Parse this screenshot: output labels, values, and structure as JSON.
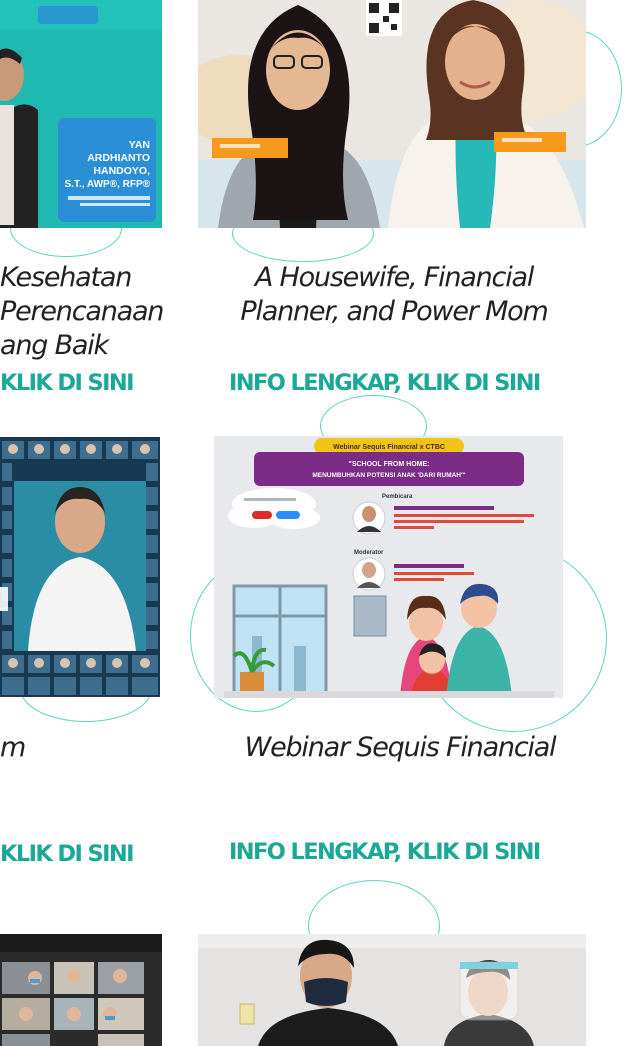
{
  "cards": {
    "top_left": {
      "caption_lines": [
        "Kesehatan",
        "Perencanaan",
        "ang Baik"
      ],
      "cta": "KLIK DI SINI",
      "image_text": {
        "name_lines": [
          "YAN",
          "ARDHIANTO",
          "HANDOYO,",
          "S.T., AWP®, RFP®"
        ]
      }
    },
    "top_right": {
      "caption_lines": [
        "A Housewife, Financial",
        "Planner, and Power Mom"
      ],
      "cta": "INFO LENGKAP, KLIK DI SINI"
    },
    "middle_left": {
      "caption_lines": [
        "m"
      ],
      "cta": "KLIK DI SINI"
    },
    "middle_right": {
      "caption_lines": [
        "Webinar Sequis Financial"
      ],
      "cta": "INFO LENGKAP, KLIK DI SINI",
      "image_text": {
        "badge": "Webinar Sequis Financial x CTBC",
        "banner_lines": [
          "\"SCHOOL FROM HOME:",
          "MENUMBUHKAN POTENSI ANAK 'DARI RUMAH'\""
        ],
        "section_1": "Pembicara",
        "section_2": "Moderator"
      }
    },
    "bottom_left": {
      "caption_lines": [],
      "cta": ""
    },
    "bottom_right": {
      "caption_lines": [],
      "cta": ""
    }
  },
  "colors": {
    "accent": "#1ba896",
    "teal_bg": "#1fb9b2",
    "deco_line": "#5fd3c4",
    "orange_tag": "#f59a1c",
    "purple_banner": "#7a2c86",
    "yellow_badge": "#f2c418"
  }
}
